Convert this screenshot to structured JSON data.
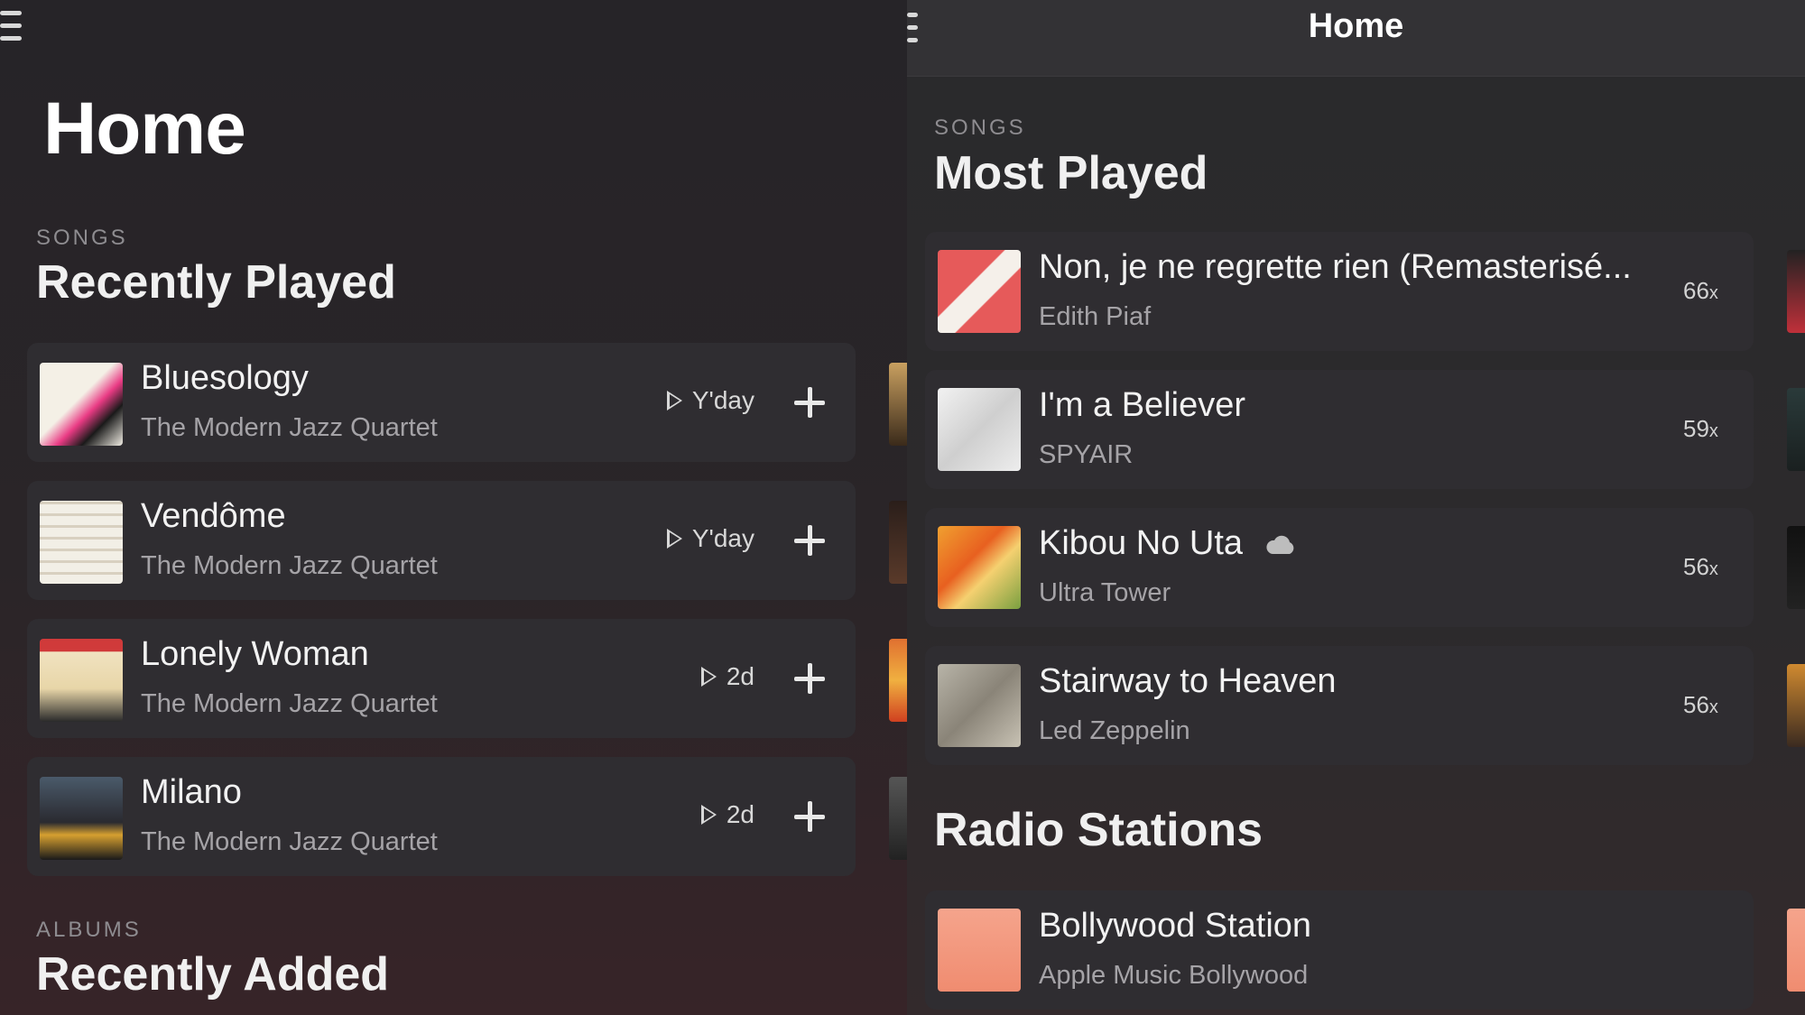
{
  "left": {
    "page_title": "Home",
    "recent_songs": {
      "kicker": "SONGS",
      "title": "Recently Played",
      "items": [
        {
          "title": "Bluesology",
          "artist": "The Modern Jazz Quartet",
          "when": "Y'day"
        },
        {
          "title": "Vendôme",
          "artist": "The Modern Jazz Quartet",
          "when": "Y'day"
        },
        {
          "title": "Lonely Woman",
          "artist": "The Modern Jazz Quartet",
          "when": "2d"
        },
        {
          "title": "Milano",
          "artist": "The Modern Jazz Quartet",
          "when": "2d"
        }
      ]
    },
    "albums": {
      "kicker": "ALBUMS",
      "title": "Recently Added"
    }
  },
  "right": {
    "nav_title": "Home",
    "most_played": {
      "kicker": "SONGS",
      "title": "Most Played",
      "items": [
        {
          "title": "Non, je ne regrette rien (Remasterisé...",
          "artist": "Edith Piaf",
          "count": "66",
          "suffix": "x"
        },
        {
          "title": "I'm a Believer",
          "artist": "SPYAIR",
          "count": "59",
          "suffix": "x"
        },
        {
          "title": "Kibou No Uta",
          "artist": "Ultra Tower",
          "count": "56",
          "suffix": "x"
        },
        {
          "title": "Stairway to Heaven",
          "artist": "Led Zeppelin",
          "count": "56",
          "suffix": "x"
        }
      ]
    },
    "radio": {
      "title": "Radio Stations",
      "items": [
        {
          "title": "Bollywood Station",
          "subtitle": "Apple Music Bollywood"
        }
      ]
    }
  },
  "colors": {
    "background": "#1e1c1f",
    "card": "#2f2d31",
    "secondary_text": "#a5a3a7"
  }
}
